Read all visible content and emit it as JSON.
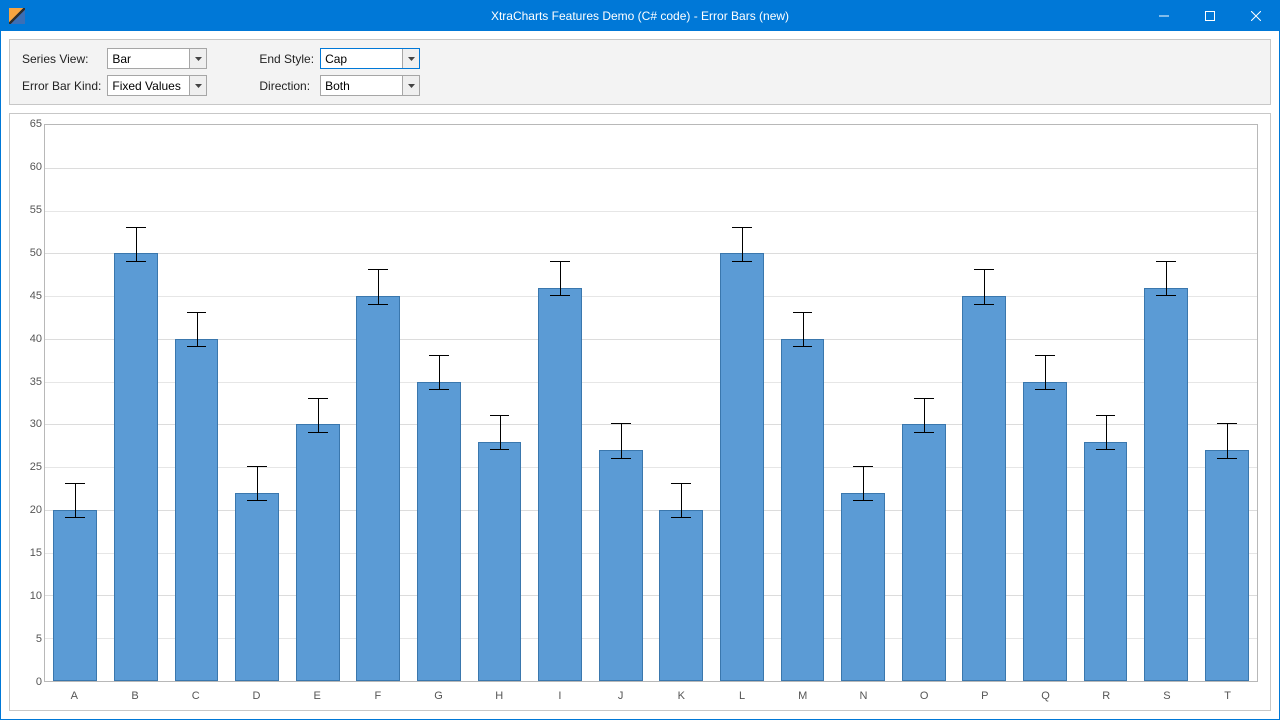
{
  "window": {
    "title": "XtraCharts Features Demo (C# code) - Error Bars (new)"
  },
  "options": {
    "series_view_label": "Series View:",
    "series_view_value": "Bar",
    "error_bar_kind_label": "Error Bar Kind:",
    "error_bar_kind_value": "Fixed Values",
    "end_style_label": "End Style:",
    "end_style_value": "Cap",
    "direction_label": "Direction:",
    "direction_value": "Both"
  },
  "chart_data": {
    "type": "bar",
    "categories": [
      "A",
      "B",
      "C",
      "D",
      "E",
      "F",
      "G",
      "H",
      "I",
      "J",
      "K",
      "L",
      "M",
      "N",
      "O",
      "P",
      "Q",
      "R",
      "S",
      "T"
    ],
    "values": [
      20,
      50,
      40,
      22,
      30,
      45,
      35,
      28,
      46,
      27,
      20,
      50,
      40,
      22,
      30,
      45,
      35,
      28,
      46,
      27
    ],
    "error_plus": 3,
    "error_minus": 1,
    "ylim": [
      0,
      65
    ],
    "ytick_interval": 5,
    "yticks": [
      0,
      5,
      10,
      15,
      20,
      25,
      30,
      35,
      40,
      45,
      50,
      55,
      60,
      65
    ],
    "title": "",
    "xlabel": "",
    "ylabel": "",
    "bar_color": "#5b9bd5",
    "bar_border": "#3a77ad",
    "error_end_style": "cap",
    "error_direction": "both"
  }
}
